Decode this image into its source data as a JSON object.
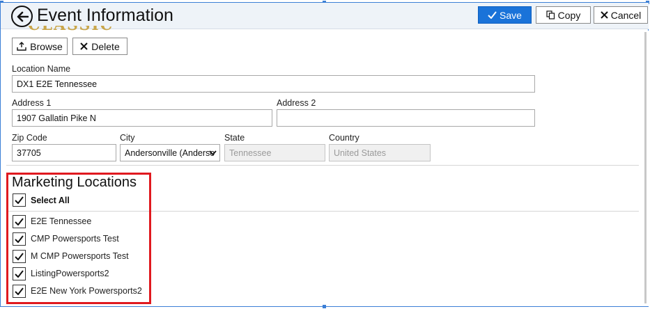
{
  "header": {
    "title": "Event Information",
    "save_label": "Save",
    "copy_label": "Copy",
    "cancel_label": "Cancel"
  },
  "image_actions": {
    "browse_label": "Browse",
    "delete_label": "Delete"
  },
  "form": {
    "location_name": {
      "label": "Location Name",
      "value": "DX1 E2E Tennessee"
    },
    "address1": {
      "label": "Address 1",
      "value": "1907 Gallatin Pike N"
    },
    "address2": {
      "label": "Address 2",
      "value": ""
    },
    "zip": {
      "label": "Zip Code",
      "value": "37705"
    },
    "city": {
      "label": "City",
      "value": "Andersonville (Anderso"
    },
    "state": {
      "label": "State",
      "value": "Tennessee"
    },
    "country": {
      "label": "Country",
      "value": "United States"
    }
  },
  "marketing": {
    "title": "Marketing Locations",
    "select_all": {
      "label": "Select All",
      "checked": true
    },
    "items": [
      {
        "label": "E2E Tennessee",
        "checked": true
      },
      {
        "label": "CMP Powersports Test",
        "checked": true
      },
      {
        "label": "M CMP Powersports Test",
        "checked": true
      },
      {
        "label": "ListingPowersports2",
        "checked": true
      },
      {
        "label": "E2E New York Powersports2",
        "checked": true
      }
    ]
  },
  "colors": {
    "accent": "#1a73d9",
    "highlight": "#e0191f",
    "selection": "#3b7fd6"
  }
}
